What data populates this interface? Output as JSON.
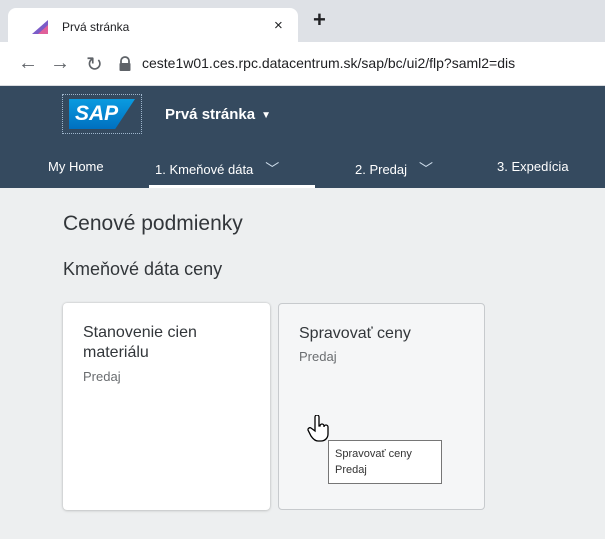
{
  "browser": {
    "tab_title": "Prvá stránka",
    "tab_close": "×",
    "new_tab": "+",
    "url": "ceste1w01.ces.rpc.datacentrum.sk/sap/bc/ui2/flp?saml2=dis"
  },
  "shell": {
    "logo_text": "SAP",
    "app_title": "Prvá stránka",
    "nav": {
      "home": "My Home",
      "kmenove": "1. Kmeňové dáta",
      "predaj": "2. Predaj",
      "expedicia": "3. Expedícia"
    }
  },
  "content": {
    "section_title": "Cenové podmienky",
    "group_title": "Kmeňové dáta ceny",
    "tiles": [
      {
        "title": "Stanovenie cien materiálu",
        "subtitle": "Predaj"
      },
      {
        "title": "Spravovať ceny",
        "subtitle": "Predaj"
      }
    ],
    "tooltip": {
      "line1": "Spravovať ceny",
      "line2": "Predaj"
    }
  },
  "colors": {
    "shell_bg": "#354a5f",
    "page_bg": "#edeff0",
    "sap_blue": "#0a9be0"
  }
}
